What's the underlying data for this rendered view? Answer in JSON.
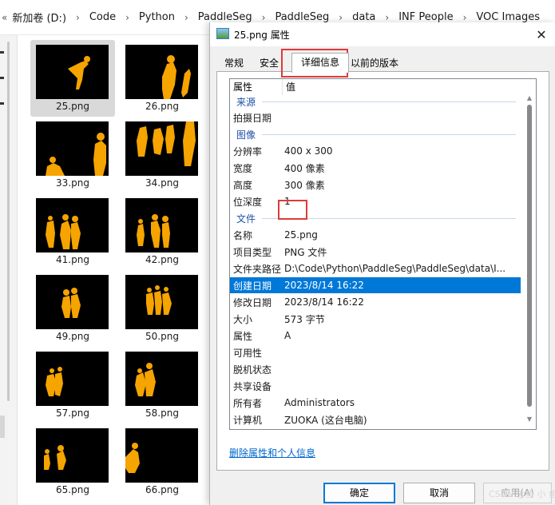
{
  "explorer": {
    "back_glyph": "«",
    "breadcrumb": [
      "新加卷 (D:)",
      "Code",
      "Python",
      "PaddleSeg",
      "PaddleSeg",
      "data",
      "INF People",
      "VOC Images"
    ],
    "separator": "›",
    "files": [
      {
        "name": "25.png",
        "selected": true
      },
      {
        "name": "26.png",
        "selected": false
      },
      {
        "name": "33.png",
        "selected": false
      },
      {
        "name": "34.png",
        "selected": false
      },
      {
        "name": "41.png",
        "selected": false
      },
      {
        "name": "42.png",
        "selected": false
      },
      {
        "name": "49.png",
        "selected": false
      },
      {
        "name": "50.png",
        "selected": false
      },
      {
        "name": "57.png",
        "selected": false
      },
      {
        "name": "58.png",
        "selected": false
      },
      {
        "name": "65.png",
        "selected": false
      },
      {
        "name": "66.png",
        "selected": false
      }
    ],
    "silhouette_color": "#f5a400"
  },
  "dialog": {
    "title": "25.png 属性",
    "close_glyph": "✕",
    "tabs": [
      "常规",
      "安全",
      "详细信息",
      "以前的版本"
    ],
    "active_tab": "详细信息",
    "columns": {
      "property": "属性",
      "value": "值"
    },
    "groups": {
      "origin": "来源",
      "image": "图像",
      "file": "文件"
    },
    "rows": {
      "date_taken": {
        "k": "拍摄日期",
        "v": ""
      },
      "resolution": {
        "k": "分辨率",
        "v": "400 x 300"
      },
      "width": {
        "k": "宽度",
        "v": "400 像素"
      },
      "height": {
        "k": "高度",
        "v": "300 像素"
      },
      "bit_depth": {
        "k": "位深度",
        "v": "1"
      },
      "name": {
        "k": "名称",
        "v": "25.png"
      },
      "item_type": {
        "k": "项目类型",
        "v": "PNG 文件"
      },
      "folder_path": {
        "k": "文件夹路径",
        "v": "D:\\Code\\Python\\PaddleSeg\\PaddleSeg\\data\\I..."
      },
      "date_created": {
        "k": "创建日期",
        "v": "2023/8/14 16:22"
      },
      "date_modified": {
        "k": "修改日期",
        "v": "2023/8/14 16:22"
      },
      "size": {
        "k": "大小",
        "v": "573 字节"
      },
      "attributes": {
        "k": "属性",
        "v": "A"
      },
      "availability": {
        "k": "可用性",
        "v": ""
      },
      "offline_status": {
        "k": "脱机状态",
        "v": ""
      },
      "shared_with": {
        "k": "共享设备",
        "v": ""
      },
      "owner": {
        "k": "所有者",
        "v": "Administrators"
      },
      "computer": {
        "k": "计算机",
        "v": "ZUOKA (这台电脑)"
      }
    },
    "remove_link": "删除属性和个人信息",
    "buttons": {
      "ok": "确定",
      "cancel": "取消",
      "apply": "应用(A)"
    },
    "selected_row": "创建日期",
    "highlight_color": "#e03a3a",
    "selection_color": "#0078d7"
  },
  "watermark": "CSDN @鱼 小 鱼"
}
